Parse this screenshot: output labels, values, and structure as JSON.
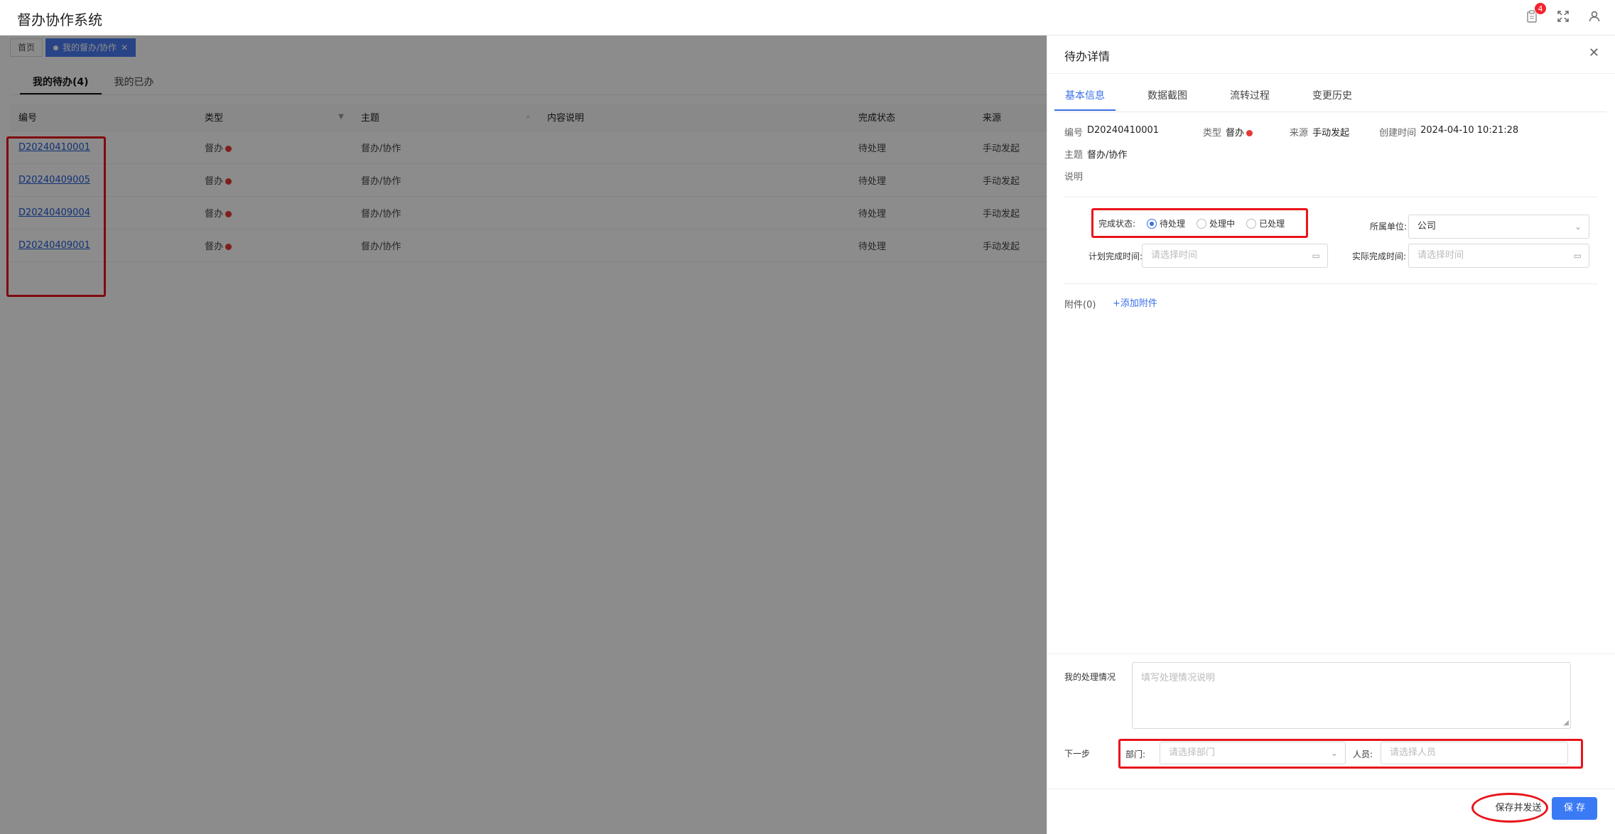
{
  "app": {
    "title": "督办协作系统",
    "notification_count": "4"
  },
  "tags": [
    {
      "label": "首页",
      "active": false
    },
    {
      "label": "我的督办/协作",
      "active": true
    }
  ],
  "subtabs": [
    "我的待办(4)",
    "我的已办"
  ],
  "table": {
    "columns": [
      "编号",
      "类型",
      "主题",
      "内容说明",
      "完成状态",
      "来源"
    ],
    "rows": [
      {
        "id": "D20240410001",
        "type": "督办",
        "subject": "督办/协作",
        "desc": "",
        "status": "待处理",
        "source": "手动发起"
      },
      {
        "id": "D20240409005",
        "type": "督办",
        "subject": "督办/协作",
        "desc": "",
        "status": "待处理",
        "source": "手动发起"
      },
      {
        "id": "D20240409004",
        "type": "督办",
        "subject": "督办/协作",
        "desc": "",
        "status": "待处理",
        "source": "手动发起"
      },
      {
        "id": "D20240409001",
        "type": "督办",
        "subject": "督办/协作",
        "desc": "",
        "status": "待处理",
        "source": "手动发起"
      }
    ]
  },
  "drawer": {
    "title": "待办详情",
    "tabs": [
      "基本信息",
      "数据截图",
      "流转过程",
      "变更历史"
    ],
    "info": {
      "id_label": "编号",
      "id_value": "D20240410001",
      "type_label": "类型",
      "type_value": "督办",
      "source_label": "来源",
      "source_value": "手动发起",
      "created_label": "创建时间",
      "created_value": "2024-04-10 10:21:28",
      "subject_label": "主题",
      "subject_value": "督办/协作",
      "desc_label": "说明"
    },
    "form": {
      "status_label": "完成状态:",
      "status_options": [
        "待处理",
        "处理中",
        "已处理"
      ],
      "status_selected": "待处理",
      "unit_label": "所属单位:",
      "unit_value": "公司",
      "plan_label": "计划完成时间:",
      "plan_placeholder": "请选择时间",
      "actual_label": "实际完成时间:",
      "actual_placeholder": "请选择时间"
    },
    "attach_label": "附件(0)",
    "attach_button": "+添加附件",
    "handling_label": "我的处理情况",
    "handling_placeholder": "填写处理情况说明",
    "next_label": "下一步",
    "dept_label": "部门:",
    "dept_placeholder": "请选择部门",
    "person_label": "人员:",
    "person_placeholder": "请选择人员",
    "save_send": "保存并发送",
    "save": "保 存"
  },
  "colors": {
    "accent": "#3a6fe8",
    "highlight": "#e8141b",
    "status_dot": "#e53935"
  }
}
